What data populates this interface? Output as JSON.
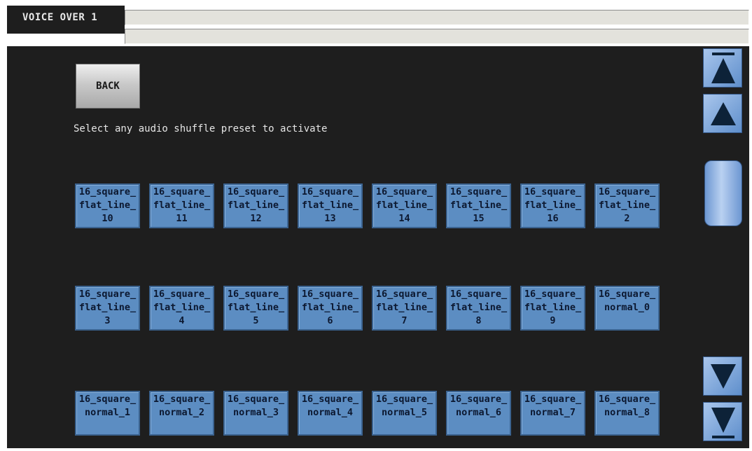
{
  "window": {
    "title": "VOICE OVER 1"
  },
  "header": {
    "field_1": "",
    "field_2": ""
  },
  "back_label": "BACK",
  "instruction": "Select any audio shuffle preset to activate",
  "presets": [
    "16_square_flat_line_10",
    "16_square_flat_line_11",
    "16_square_flat_line_12",
    "16_square_flat_line_13",
    "16_square_flat_line_14",
    "16_square_flat_line_15",
    "16_square_flat_line_16",
    "16_square_flat_line_2",
    "16_square_flat_line_3",
    "16_square_flat_line_4",
    "16_square_flat_line_5",
    "16_square_flat_line_6",
    "16_square_flat_line_7",
    "16_square_flat_line_8",
    "16_square_flat_line_9",
    "16_square_normal_0",
    "16_square_normal_1",
    "16_square_normal_2",
    "16_square_normal_3",
    "16_square_normal_4",
    "16_square_normal_5",
    "16_square_normal_6",
    "16_square_normal_7",
    "16_square_normal_8"
  ],
  "scrollbar": {
    "buttons": [
      "triangle-up-to-top-icon",
      "triangle-up-icon",
      "triangle-down-icon",
      "triangle-down-to-bottom-icon"
    ]
  },
  "colors": {
    "panel_bg": "#1e1e1e",
    "preset_button": "#5c8dc2",
    "preset_text": "#0c1830",
    "scroll_blue": "#7aa4dc",
    "header_field": "#e3e2dc"
  }
}
